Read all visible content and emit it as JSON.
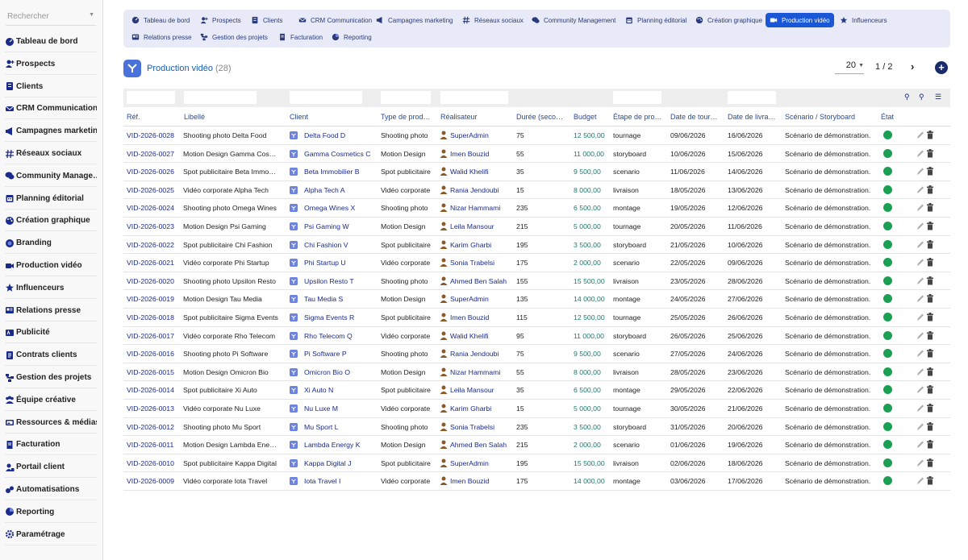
{
  "search": {
    "placeholder": "Rechercher"
  },
  "sidebar": {
    "items": [
      {
        "label": "Tableau de bord",
        "icon": "dashboard-icon"
      },
      {
        "label": "Prospects",
        "icon": "user-plus-icon"
      },
      {
        "label": "Clients",
        "icon": "clients-icon"
      },
      {
        "label": "CRM Communication",
        "icon": "crm-icon"
      },
      {
        "label": "Campagnes marketing",
        "icon": "megaphone-icon"
      },
      {
        "label": "Réseaux sociaux",
        "icon": "hashtag-icon"
      },
      {
        "label": "Community Manage…",
        "icon": "comments-icon"
      },
      {
        "label": "Planning éditorial",
        "icon": "calendar-icon"
      },
      {
        "label": "Création graphique",
        "icon": "palette-icon"
      },
      {
        "label": "Branding",
        "icon": "branding-icon"
      },
      {
        "label": "Production vidéo",
        "icon": "video-icon"
      },
      {
        "label": "Influenceurs",
        "icon": "star-icon"
      },
      {
        "label": "Relations presse",
        "icon": "newspaper-icon"
      },
      {
        "label": "Publicité",
        "icon": "ad-icon"
      },
      {
        "label": "Contrats clients",
        "icon": "contract-icon"
      },
      {
        "label": "Gestion des projets",
        "icon": "project-icon"
      },
      {
        "label": "Équipe créative",
        "icon": "team-icon"
      },
      {
        "label": "Ressources & médias",
        "icon": "media-icon"
      },
      {
        "label": "Facturation",
        "icon": "invoice-icon"
      },
      {
        "label": "Portail client",
        "icon": "portal-icon"
      },
      {
        "label": "Automatisations",
        "icon": "automation-icon"
      },
      {
        "label": "Reporting",
        "icon": "reporting-icon"
      },
      {
        "label": "Paramétrage",
        "icon": "gear-icon"
      }
    ]
  },
  "topmenu": {
    "items": [
      {
        "label": "Tableau de bord",
        "icon": "dashboard-icon",
        "active": false
      },
      {
        "label": "Prospects",
        "icon": "user-plus-icon",
        "active": false
      },
      {
        "label": "Clients",
        "icon": "clients-icon",
        "active": false
      },
      {
        "label": "CRM Communication",
        "icon": "crm-icon",
        "active": false
      },
      {
        "label": "Campagnes marketing",
        "icon": "megaphone-icon",
        "active": false
      },
      {
        "label": "Réseaux sociaux",
        "icon": "hashtag-icon",
        "active": false
      },
      {
        "label": "Community Management",
        "icon": "comments-icon",
        "active": false
      },
      {
        "label": "Planning éditorial",
        "icon": "calendar-icon",
        "active": false
      },
      {
        "label": "Création graphique",
        "icon": "palette-icon",
        "active": false
      },
      {
        "label": "Production vidéo",
        "icon": "video-icon",
        "active": true
      },
      {
        "label": "Influenceurs",
        "icon": "star-icon",
        "active": false
      },
      {
        "label": "Relations presse",
        "icon": "newspaper-icon",
        "active": false
      },
      {
        "label": "Gestion des projets",
        "icon": "project-icon",
        "active": false
      },
      {
        "label": "Facturation",
        "icon": "invoice-icon",
        "active": false
      },
      {
        "label": "Reporting",
        "icon": "reporting-icon",
        "active": false
      }
    ]
  },
  "page": {
    "title": "Production vidéo",
    "count": "(28)",
    "limit": "20",
    "page_current": "1",
    "page_sep": "/",
    "page_total": "2"
  },
  "colors": {
    "accent": "#1a57d6",
    "link": "#1a2b8c",
    "budget": "#1e7a6e",
    "status_ok": "#1aa052"
  },
  "table": {
    "columns": [
      "Réf.",
      "Libellé",
      "Client",
      "Type de prod…",
      "Réalisateur",
      "Durée (seco…",
      "Budget",
      "Étape de pro…",
      "Date de tour…",
      "Date de livra…",
      "Scénario / Storyboard",
      "État"
    ],
    "rows": [
      {
        "ref": "VID-2026-0028",
        "libelle": "Shooting photo Delta Food",
        "client": "Delta Food D",
        "type": "Shooting photo",
        "realisateur": "SuperAdmin",
        "duree": "75",
        "budget": "12 500,00",
        "etape": "tournage",
        "date_tournage": "09/06/2026",
        "date_livraison": "16/06/2026",
        "scenario": "Scénario de démonstration."
      },
      {
        "ref": "VID-2026-0027",
        "libelle": "Motion Design Gamma Cos…",
        "client": "Gamma Cosmetics C",
        "type": "Motion Design",
        "realisateur": "Imen Bouzid",
        "duree": "55",
        "budget": "11 000,00",
        "etape": "storyboard",
        "date_tournage": "10/06/2026",
        "date_livraison": "15/06/2026",
        "scenario": "Scénario de démonstration."
      },
      {
        "ref": "VID-2026-0026",
        "libelle": "Spot publicitaire Beta Immo…",
        "client": "Beta Immobilier B",
        "type": "Spot publicitaire",
        "realisateur": "Walid Khelifi",
        "duree": "35",
        "budget": "9 500,00",
        "etape": "scenario",
        "date_tournage": "11/06/2026",
        "date_livraison": "14/06/2026",
        "scenario": "Scénario de démonstration."
      },
      {
        "ref": "VID-2026-0025",
        "libelle": "Vidéo corporate Alpha Tech",
        "client": "Alpha Tech A",
        "type": "Vidéo corporate",
        "realisateur": "Rania Jendoubi",
        "duree": "15",
        "budget": "8 000,00",
        "etape": "livraison",
        "date_tournage": "18/05/2026",
        "date_livraison": "13/06/2026",
        "scenario": "Scénario de démonstration."
      },
      {
        "ref": "VID-2026-0024",
        "libelle": "Shooting photo Omega Wines",
        "client": "Omega Wines X",
        "type": "Shooting photo",
        "realisateur": "Nizar Hammami",
        "duree": "235",
        "budget": "6 500,00",
        "etape": "montage",
        "date_tournage": "19/05/2026",
        "date_livraison": "12/06/2026",
        "scenario": "Scénario de démonstration."
      },
      {
        "ref": "VID-2026-0023",
        "libelle": "Motion Design Psi Gaming",
        "client": "Psi Gaming W",
        "type": "Motion Design",
        "realisateur": "Leila Mansour",
        "duree": "215",
        "budget": "5 000,00",
        "etape": "tournage",
        "date_tournage": "20/05/2026",
        "date_livraison": "11/06/2026",
        "scenario": "Scénario de démonstration."
      },
      {
        "ref": "VID-2026-0022",
        "libelle": "Spot publicitaire Chi Fashion",
        "client": "Chi Fashion V",
        "type": "Spot publicitaire",
        "realisateur": "Karim Gharbi",
        "duree": "195",
        "budget": "3 500,00",
        "etape": "storyboard",
        "date_tournage": "21/05/2026",
        "date_livraison": "10/06/2026",
        "scenario": "Scénario de démonstration."
      },
      {
        "ref": "VID-2026-0021",
        "libelle": "Vidéo corporate Phi Startup",
        "client": "Phi Startup U",
        "type": "Vidéo corporate",
        "realisateur": "Sonia Trabelsi",
        "duree": "175",
        "budget": "2 000,00",
        "etape": "scenario",
        "date_tournage": "22/05/2026",
        "date_livraison": "09/06/2026",
        "scenario": "Scénario de démonstration."
      },
      {
        "ref": "VID-2026-0020",
        "libelle": "Shooting photo Upsilon Resto",
        "client": "Upsilon Resto T",
        "type": "Shooting photo",
        "realisateur": "Ahmed Ben Salah",
        "duree": "155",
        "budget": "15 500,00",
        "etape": "livraison",
        "date_tournage": "23/05/2026",
        "date_livraison": "28/06/2026",
        "scenario": "Scénario de démonstration."
      },
      {
        "ref": "VID-2026-0019",
        "libelle": "Motion Design Tau Media",
        "client": "Tau Media S",
        "type": "Motion Design",
        "realisateur": "SuperAdmin",
        "duree": "135",
        "budget": "14 000,00",
        "etape": "montage",
        "date_tournage": "24/05/2026",
        "date_livraison": "27/06/2026",
        "scenario": "Scénario de démonstration."
      },
      {
        "ref": "VID-2026-0018",
        "libelle": "Spot publicitaire Sigma Events",
        "client": "Sigma Events R",
        "type": "Spot publicitaire",
        "realisateur": "Imen Bouzid",
        "duree": "115",
        "budget": "12 500,00",
        "etape": "tournage",
        "date_tournage": "25/05/2026",
        "date_livraison": "26/06/2026",
        "scenario": "Scénario de démonstration."
      },
      {
        "ref": "VID-2026-0017",
        "libelle": "Vidéo corporate Rho Telecom",
        "client": "Rho Telecom Q",
        "type": "Vidéo corporate",
        "realisateur": "Walid Khelifi",
        "duree": "95",
        "budget": "11 000,00",
        "etape": "storyboard",
        "date_tournage": "26/05/2026",
        "date_livraison": "25/06/2026",
        "scenario": "Scénario de démonstration."
      },
      {
        "ref": "VID-2026-0016",
        "libelle": "Shooting photo Pi Software",
        "client": "Pi Software P",
        "type": "Shooting photo",
        "realisateur": "Rania Jendoubi",
        "duree": "75",
        "budget": "9 500,00",
        "etape": "scenario",
        "date_tournage": "27/05/2026",
        "date_livraison": "24/06/2026",
        "scenario": "Scénario de démonstration."
      },
      {
        "ref": "VID-2026-0015",
        "libelle": "Motion Design Omicron Bio",
        "client": "Omicron Bio O",
        "type": "Motion Design",
        "realisateur": "Nizar Hammami",
        "duree": "55",
        "budget": "8 000,00",
        "etape": "livraison",
        "date_tournage": "28/05/2026",
        "date_livraison": "23/06/2026",
        "scenario": "Scénario de démonstration."
      },
      {
        "ref": "VID-2026-0014",
        "libelle": "Spot publicitaire Xi Auto",
        "client": "Xi Auto N",
        "type": "Spot publicitaire",
        "realisateur": "Leila Mansour",
        "duree": "35",
        "budget": "6 500,00",
        "etape": "montage",
        "date_tournage": "29/05/2026",
        "date_livraison": "22/06/2026",
        "scenario": "Scénario de démonstration."
      },
      {
        "ref": "VID-2026-0013",
        "libelle": "Vidéo corporate Nu Luxe",
        "client": "Nu Luxe M",
        "type": "Vidéo corporate",
        "realisateur": "Karim Gharbi",
        "duree": "15",
        "budget": "5 000,00",
        "etape": "tournage",
        "date_tournage": "30/05/2026",
        "date_livraison": "21/06/2026",
        "scenario": "Scénario de démonstration."
      },
      {
        "ref": "VID-2026-0012",
        "libelle": "Shooting photo Mu Sport",
        "client": "Mu Sport L",
        "type": "Shooting photo",
        "realisateur": "Sonia Trabelsi",
        "duree": "235",
        "budget": "3 500,00",
        "etape": "storyboard",
        "date_tournage": "31/05/2026",
        "date_livraison": "20/06/2026",
        "scenario": "Scénario de démonstration."
      },
      {
        "ref": "VID-2026-0011",
        "libelle": "Motion Design Lambda Ene…",
        "client": "Lambda Energy K",
        "type": "Motion Design",
        "realisateur": "Ahmed Ben Salah",
        "duree": "215",
        "budget": "2 000,00",
        "etape": "scenario",
        "date_tournage": "01/06/2026",
        "date_livraison": "19/06/2026",
        "scenario": "Scénario de démonstration."
      },
      {
        "ref": "VID-2026-0010",
        "libelle": "Spot publicitaire Kappa Digital",
        "client": "Kappa Digital J",
        "type": "Spot publicitaire",
        "realisateur": "SuperAdmin",
        "duree": "195",
        "budget": "15 500,00",
        "etape": "livraison",
        "date_tournage": "02/06/2026",
        "date_livraison": "18/06/2026",
        "scenario": "Scénario de démonstration."
      },
      {
        "ref": "VID-2026-0009",
        "libelle": "Vidéo corporate Iota Travel",
        "client": "Iota Travel I",
        "type": "Vidéo corporate",
        "realisateur": "Imen Bouzid",
        "duree": "175",
        "budget": "14 000,00",
        "etape": "montage",
        "date_tournage": "03/06/2026",
        "date_livraison": "17/06/2026",
        "scenario": "Scénario de démonstration."
      }
    ]
  }
}
